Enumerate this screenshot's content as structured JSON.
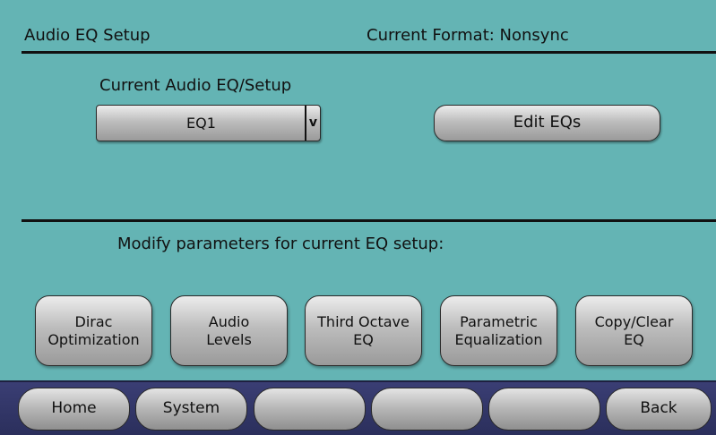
{
  "header": {
    "title": "Audio EQ Setup",
    "format": "Current Format: Nonsync"
  },
  "eq_setup": {
    "label": "Current Audio EQ/Setup",
    "selected": "EQ1",
    "chevron": "v",
    "edit_label": "Edit EQs"
  },
  "modify": {
    "label": "Modify parameters for current EQ setup:",
    "buttons": [
      {
        "line1": "Dirac",
        "line2": "Optimization"
      },
      {
        "line1": "Audio",
        "line2": "Levels"
      },
      {
        "line1": "Third Octave",
        "line2": "EQ"
      },
      {
        "line1": "Parametric",
        "line2": "Equalization"
      },
      {
        "line1": "Copy/Clear",
        "line2": "EQ"
      }
    ]
  },
  "nav": {
    "home": "Home",
    "system": "System",
    "blank1": "",
    "blank2": "",
    "blank3": "",
    "back": "Back"
  },
  "colors": {
    "background": "#64b4b4",
    "navbar": "#2e3262"
  }
}
